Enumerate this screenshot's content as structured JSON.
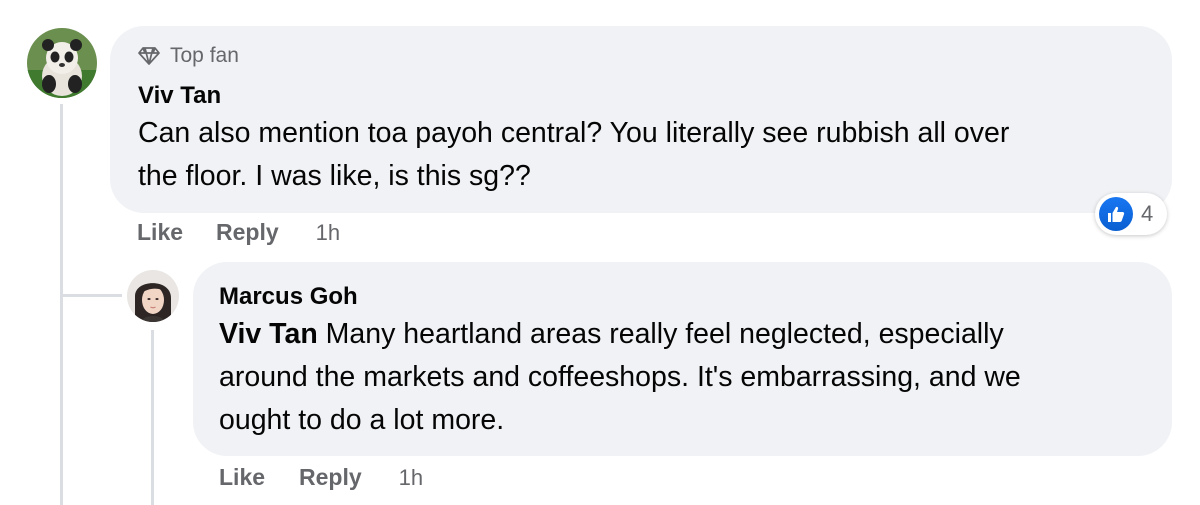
{
  "comment": {
    "badge": "Top fan",
    "author": "Viv Tan",
    "text_line1": "Can also mention toa payoh central? You literally see rubbish all over",
    "text_line2": "the floor. I was like, is this sg??",
    "actions": {
      "like": "Like",
      "reply": "Reply",
      "time": "1h"
    },
    "reactions": {
      "icon": "like-icon",
      "count": "4"
    }
  },
  "reply": {
    "author": "Marcus Goh",
    "mention": "Viv Tan",
    "text_line1": "Many heartland areas really feel neglected, especially",
    "text_line2": "around the markets and coffeeshops. It's embarrassing, and we",
    "text_line3": "ought to do a lot more.",
    "actions": {
      "like": "Like",
      "reply": "Reply",
      "time": "1h"
    }
  },
  "colors": {
    "bubble": "#f0f2f5",
    "secondary_text": "#65676b",
    "like_blue": "#1877f2",
    "thread_line": "#dadde1"
  }
}
